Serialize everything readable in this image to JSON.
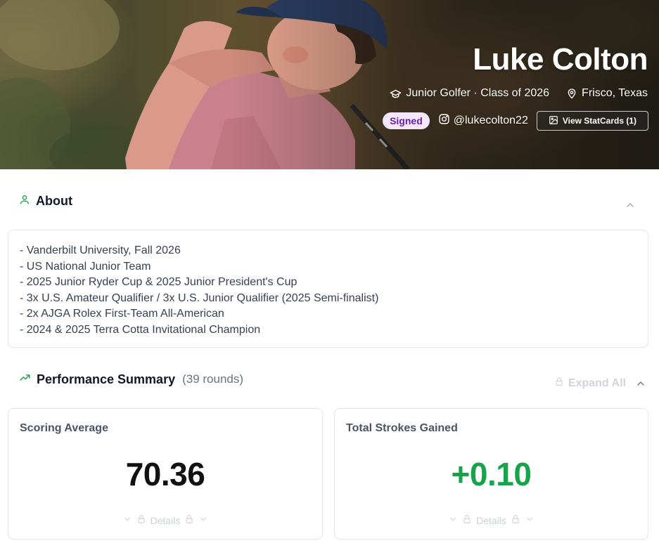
{
  "profile": {
    "name": "Luke Colton",
    "role": "Junior Golfer · Class of 2026",
    "location": "Frisco, Texas",
    "status_badge": "Signed",
    "instagram": "@lukecolton22",
    "statcards_button": "View StatCards (1)"
  },
  "about": {
    "title": "About",
    "lines": [
      "- Vanderbilt University, Fall 2026",
      "- US National Junior Team",
      "- 2025 Junior Ryder Cup & 2025 Junior President's Cup",
      "- 3x U.S. Amateur Qualifier / 3x U.S. Junior Qualifier (2025 Semi-finalist)",
      "- 2x AJGA Rolex First-Team All-American",
      "- 2024 & 2025 Terra Cotta Invitational Champion"
    ]
  },
  "performance": {
    "title": "Performance Summary",
    "rounds": "(39 rounds)",
    "expand_all": "Expand All",
    "cards": [
      {
        "label": "Scoring Average",
        "value": "70.36",
        "details": "Details",
        "value_color": "#111111"
      },
      {
        "label": "Total Strokes Gained",
        "value": "+0.10",
        "details": "Details",
        "value_color": "#16a34a"
      }
    ]
  },
  "colors": {
    "accent_green": "#16a34a",
    "signed_bg": "#f3e8ff",
    "signed_text": "#6b21a8"
  },
  "icons": {
    "about": "user-icon",
    "performance": "trending-up-icon",
    "role": "graduation-cap-icon",
    "location": "map-pin-icon",
    "instagram": "instagram-icon",
    "statcards": "image-icon",
    "lock": "lock-icon",
    "collapse": "chevron-up-icon"
  }
}
